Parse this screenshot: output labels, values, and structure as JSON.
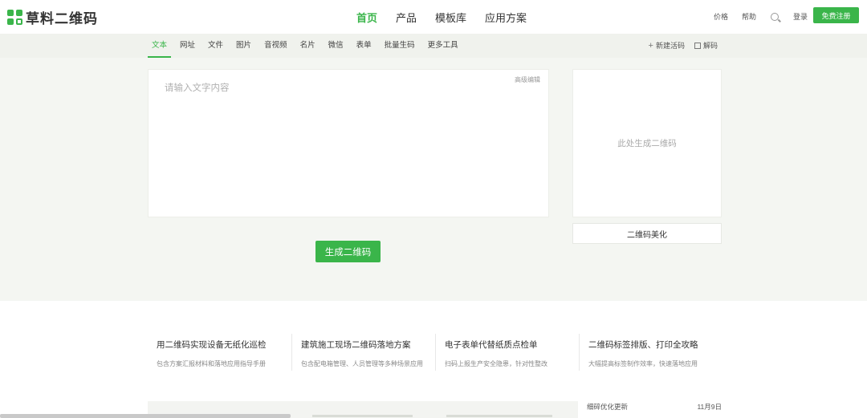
{
  "brand": {
    "name": "草料二维码",
    "accent": "#3ab54a"
  },
  "main_nav": [
    {
      "label": "首页",
      "active": true
    },
    {
      "label": "产品",
      "active": false
    },
    {
      "label": "模板库",
      "active": false
    },
    {
      "label": "应用方案",
      "active": false
    }
  ],
  "top_links": {
    "price": "价格",
    "help": "帮助",
    "login": "登录",
    "register": "免费注册"
  },
  "sub_tabs": [
    {
      "label": "文本",
      "active": true
    },
    {
      "label": "网址",
      "active": false
    },
    {
      "label": "文件",
      "active": false
    },
    {
      "label": "图片",
      "active": false
    },
    {
      "label": "音视频",
      "active": false
    },
    {
      "label": "名片",
      "active": false
    },
    {
      "label": "微信",
      "active": false
    },
    {
      "label": "表单",
      "active": false
    },
    {
      "label": "批量生码",
      "active": false
    },
    {
      "label": "更多工具",
      "active": false
    }
  ],
  "sub_right": {
    "new_code": "新建活码",
    "decode": "解码"
  },
  "editor": {
    "placeholder": "请输入文字内容",
    "value": "",
    "advanced": "高级编辑"
  },
  "generate_button": "生成二维码",
  "qr_preview": {
    "placeholder": "此处生成二维码",
    "beautify": "二维码美化"
  },
  "articles": [
    {
      "title": "用二维码实现设备无纸化巡检",
      "desc": "包含方案汇报材料和落地应用指导手册"
    },
    {
      "title": "建筑施工现场二维码落地方案",
      "desc": "包含配电箱管理、人员管理等多种场景应用"
    },
    {
      "title": "电子表单代替纸质点检单",
      "desc": "扫码上报生产安全隐患，针对性整改"
    },
    {
      "title": "二维码标签排版、打印全攻略",
      "desc": "大幅提高标签制作效率，快速落地应用"
    }
  ],
  "update": {
    "label": "细碎优化更新",
    "date": "11月9日"
  }
}
